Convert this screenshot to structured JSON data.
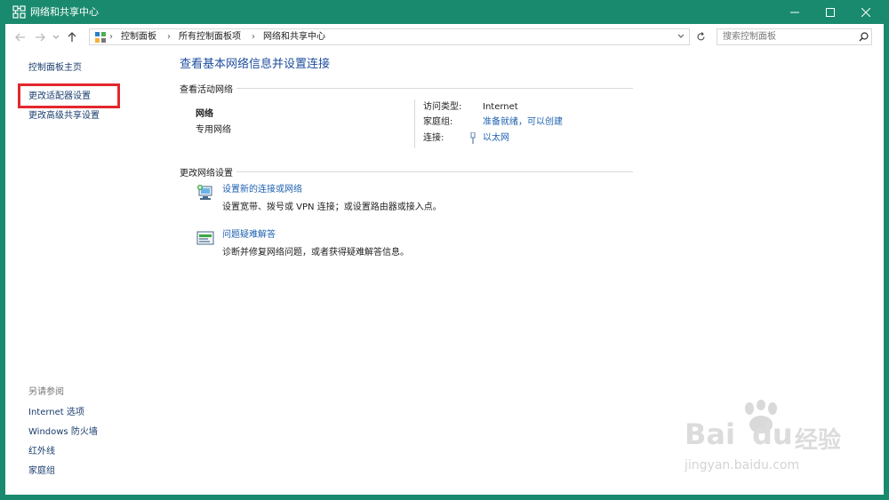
{
  "window": {
    "title": "网络和共享中心"
  },
  "address": {
    "crumbs": [
      "控制面板",
      "所有控制面板项",
      "网络和共享中心"
    ],
    "separator": "›"
  },
  "search": {
    "placeholder": "搜索控制面板"
  },
  "sidebar": {
    "links": [
      "控制面板主页",
      "更改适配器设置",
      "更改高级共享设置"
    ],
    "see_also_label": "另请参阅",
    "see_also_links": [
      "Internet 选项",
      "Windows 防火墙",
      "红外线",
      "家庭组"
    ]
  },
  "main": {
    "title": "查看基本网络信息并设置连接",
    "active_section": "查看活动网络",
    "network": {
      "name": "网络",
      "type": "专用网络",
      "access_label": "访问类型:",
      "access_value": "Internet",
      "homegroup_label": "家庭组:",
      "homegroup_value": "准备就绪，可以创建",
      "connection_label": "连接:",
      "connection_value": "以太网"
    },
    "change_section": "更改网络设置",
    "tasks": [
      {
        "title": "设置新的连接或网络",
        "desc": "设置宽带、拨号或 VPN 连接；或设置路由器或接入点。"
      },
      {
        "title": "问题疑难解答",
        "desc": "诊断并修复网络问题，或者获得疑难解答信息。"
      }
    ]
  },
  "watermark": {
    "brand": "Bai",
    "brand2": "du",
    "cn": "经验",
    "url": "jingyan.baidu.com"
  },
  "colors": {
    "titlebar": "#1a8a6e",
    "link": "#1e60b0",
    "highlight": "#e2282d"
  }
}
